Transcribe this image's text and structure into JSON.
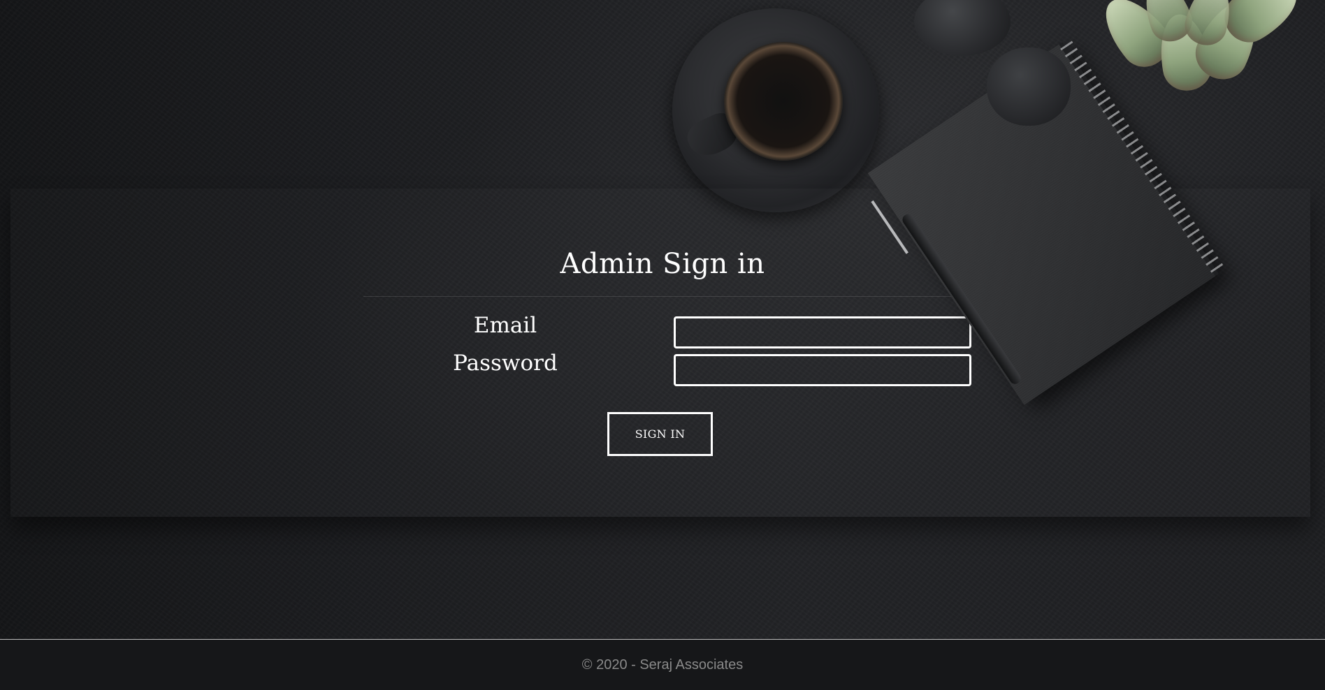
{
  "login": {
    "title": "Admin Sign in",
    "email_label": "Email",
    "email_value": "",
    "password_label": "Password",
    "password_value": "",
    "submit_label": "SIGN IN"
  },
  "footer": {
    "copyright": "© 2020 - Seraj Associates"
  }
}
